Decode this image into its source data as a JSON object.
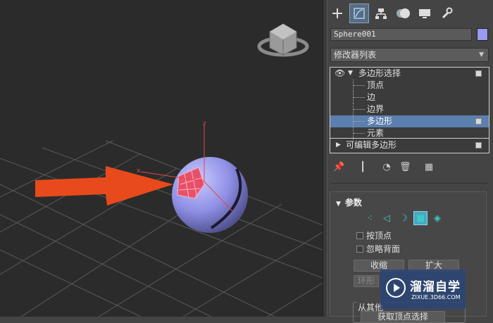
{
  "viewport": {
    "axis_labels": {
      "z": "z",
      "x": "x"
    },
    "annotation_color": "#e84a1c",
    "sphere_color": "#8f8fe6",
    "selection_color": "#e8506a"
  },
  "command_panel": {
    "tabs": [
      {
        "icon": "create-plus-icon"
      },
      {
        "icon": "modify-icon",
        "active": true
      },
      {
        "icon": "hierarchy-icon"
      },
      {
        "icon": "motion-icon"
      },
      {
        "icon": "display-icon"
      },
      {
        "icon": "utilities-wrench-icon"
      }
    ],
    "object_name": "Sphere001",
    "object_color": "#9a9af0",
    "modifier_list_label": "修改器列表",
    "stack": [
      {
        "label": "多边形选择",
        "level": 0,
        "expanded": true,
        "eye": true
      },
      {
        "label": "顶点",
        "level": 1
      },
      {
        "label": "边",
        "level": 1
      },
      {
        "label": "边界",
        "level": 1
      },
      {
        "label": "多边形",
        "level": 1,
        "selected": true
      },
      {
        "label": "元素",
        "level": 1
      },
      {
        "label": "可编辑多边形",
        "level": 0,
        "expanded": false
      }
    ],
    "stack_tools": [
      "pin-stack-icon",
      "show-end-result-icon",
      "make-unique-icon",
      "remove-modifier-icon",
      "configure-modifier-sets-icon"
    ],
    "parameters": {
      "title": "参数",
      "subobject_icons": [
        "vertex-icon",
        "edge-icon",
        "border-icon",
        "polygon-icon",
        "element-icon"
      ],
      "by_vertex_label": "按顶点",
      "ignore_backfacing_label": "忽略背面",
      "shrink_label": "收缩",
      "grow_label": "扩大",
      "ring_label": "环形",
      "get_from_other_label": "从其他",
      "get_vertex_selection_label": "获取顶点选择"
    }
  },
  "watermark": {
    "title": "溜溜自学",
    "subtitle": "ZIXUE.3D66.COM"
  }
}
